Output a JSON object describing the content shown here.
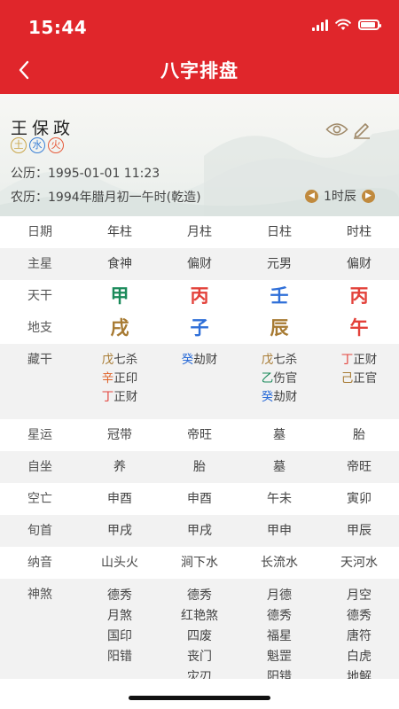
{
  "status_bar": {
    "time": "15:44"
  },
  "nav": {
    "back_glyph": "‹",
    "title": "八字排盘"
  },
  "profile": {
    "name": "王保政",
    "elements": [
      "土",
      "水",
      "火"
    ],
    "solar_label": "公历：1995-01-01 11:23",
    "lunar_label": "农历：1994年腊月初一午时(乾造)",
    "hour_label": "1时辰"
  },
  "colors": {
    "brand_red": "#e0262b",
    "green": "#1a8a5a",
    "red": "#e3413a",
    "blue": "#2f6fd8",
    "brown": "#a77a32",
    "orange": "#e0632a"
  },
  "table": {
    "header": [
      "日期",
      "年柱",
      "月柱",
      "日柱",
      "时柱"
    ],
    "zhuxing": {
      "label": "主星",
      "values": [
        "食神",
        "偏财",
        "元男",
        "偏财"
      ]
    },
    "tiangan": {
      "label": "天干",
      "values": [
        "甲",
        "丙",
        "壬",
        "丙"
      ]
    },
    "dizhi": {
      "label": "地支",
      "values": [
        "戌",
        "子",
        "辰",
        "午"
      ]
    },
    "canggan": {
      "label": "藏干",
      "columns": [
        [
          {
            "gan": "戊",
            "god": "七杀"
          },
          {
            "gan": "辛",
            "god": "正印"
          },
          {
            "gan": "丁",
            "god": "正财"
          }
        ],
        [
          {
            "gan": "癸",
            "god": "劫财"
          }
        ],
        [
          {
            "gan": "戊",
            "god": "七杀"
          },
          {
            "gan": "乙",
            "god": "伤官"
          },
          {
            "gan": "癸",
            "god": "劫财"
          }
        ],
        [
          {
            "gan": "丁",
            "god": "正财"
          },
          {
            "gan": "己",
            "god": "正官"
          }
        ]
      ]
    },
    "xingyun": {
      "label": "星运",
      "values": [
        "冠带",
        "帝旺",
        "墓",
        "胎"
      ]
    },
    "zizuo": {
      "label": "自坐",
      "values": [
        "养",
        "胎",
        "墓",
        "帝旺"
      ]
    },
    "kongwang": {
      "label": "空亡",
      "values": [
        "申酉",
        "申酉",
        "午未",
        "寅卯"
      ]
    },
    "xunshou": {
      "label": "旬首",
      "values": [
        "甲戌",
        "甲戌",
        "甲申",
        "甲辰"
      ]
    },
    "nayin": {
      "label": "纳音",
      "values": [
        "山头火",
        "涧下水",
        "长流水",
        "天河水"
      ]
    },
    "shensha": {
      "label": "神煞",
      "columns": [
        [
          "德秀",
          "月煞",
          "国印",
          "阳错"
        ],
        [
          "德秀",
          "红艳煞",
          "四废",
          "丧门",
          "灾刃"
        ],
        [
          "月德",
          "德秀",
          "福星",
          "魁罡",
          "阳错"
        ],
        [
          "月空",
          "德秀",
          "唐符",
          "白虎",
          "地解"
        ]
      ]
    }
  }
}
